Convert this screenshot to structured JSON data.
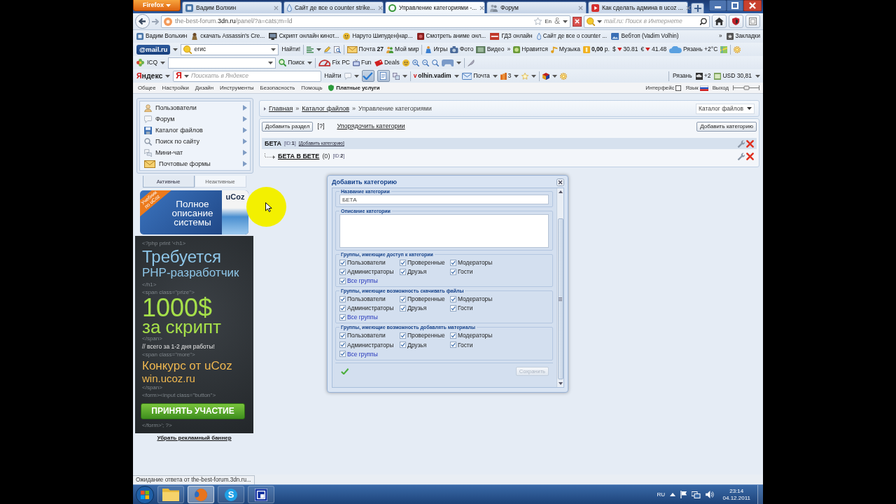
{
  "tab_strip": {
    "menu_button": "Firefox",
    "tabs": [
      {
        "title": "Вадим Волхин",
        "kind": "tile",
        "selected": false
      },
      {
        "title": "Сайт де все о counter strike...",
        "kind": "drop",
        "selected": false
      },
      {
        "title": "Управление категориями -...",
        "kind": "loading",
        "selected": true
      },
      {
        "title": "Форум",
        "kind": "forum",
        "selected": false
      },
      {
        "title": "Как сделать админа в ucoz ...",
        "kind": "video",
        "selected": false
      }
    ]
  },
  "nav_bar": {
    "url": {
      "host": "the-best-forum.",
      "domain": "3dn.ru",
      "path": "/panel/?a=cats;m=ld"
    },
    "addons": [
      "En",
      "&"
    ],
    "search": {
      "placeholder": "mail.ru: Поиск в Интернете"
    }
  },
  "bookmarks_bar": {
    "items": [
      {
        "label": "Вадим Вольхин",
        "kind": "tile"
      },
      {
        "label": "скачать Assassin's Cre...",
        "kind": "figure"
      },
      {
        "label": "Скрипт онлайн кинот...",
        "kind": "monitor"
      },
      {
        "label": "Наруто Шипуден|нар...",
        "kind": "emoji"
      },
      {
        "label": "Смотреть аниме онл...",
        "kind": "picture"
      },
      {
        "label": "ГДЗ онлайн",
        "kind": "logo"
      },
      {
        "label": "Сайт де все о counter ...",
        "kind": "drop"
      },
      {
        "label": "Вебтоп (Vadim Volhin)",
        "kind": "landscape"
      }
    ],
    "overflow": "»",
    "menu": "Закладки"
  },
  "mail_toolbar": {
    "logo": "@mail.ru",
    "search": {
      "value": "егис"
    },
    "search_button": "Найти!",
    "items": [
      {
        "kind": "fontsize"
      },
      {
        "kind": "caret"
      },
      {
        "kind": "pen"
      },
      {
        "kind": "pagesearch"
      },
      {
        "kind": "sep"
      },
      {
        "kind": "envelope",
        "label": "Почта **27**"
      },
      {
        "kind": "people",
        "label": "Мой мир"
      },
      {
        "kind": "sep"
      },
      {
        "kind": "figure2",
        "label": "Игры"
      },
      {
        "kind": "camera",
        "label": "Фото"
      },
      {
        "kind": "film",
        "label": "Видео"
      },
      {
        "kind": "text",
        "label": "»"
      },
      {
        "kind": "like",
        "label": "Нравится"
      },
      {
        "kind": "music",
        "label": "Музыка"
      },
      {
        "kind": "coin",
        "label": "**0,00** р."
      },
      {
        "kind": "rate",
        "symbol": "$",
        "label": "30.81"
      },
      {
        "kind": "rate",
        "symbol": "€",
        "label": "41.48"
      },
      {
        "kind": "cloud",
        "label": "Рязань +2°C"
      },
      {
        "kind": "map"
      },
      {
        "kind": "sep"
      },
      {
        "kind": "gear"
      }
    ]
  },
  "icq_toolbar": {
    "label": "ICQ",
    "search_button": "Поиск",
    "items": [
      {
        "kind": "caret"
      },
      {
        "kind": "sep"
      },
      {
        "kind": "fixpc",
        "label": "Fix PC"
      },
      {
        "kind": "tv",
        "label": "Fun"
      },
      {
        "kind": "ticket",
        "label": "Deals"
      },
      {
        "kind": "emoji"
      },
      {
        "kind": "zoomin"
      },
      {
        "kind": "zoomout"
      },
      {
        "kind": "zoom"
      },
      {
        "kind": "gamepad"
      },
      {
        "kind": "caret"
      },
      {
        "kind": "sep"
      },
      {
        "kind": "feather"
      }
    ]
  },
  "yandex_toolbar": {
    "logo": "Яндекс",
    "search": {
      "glyph": "Я",
      "placeholder": "Поискать в Яндексе"
    },
    "search_button": "Найти",
    "items": [
      {
        "kind": "bubble"
      },
      {
        "kind": "caret"
      }
    ],
    "toggles": [
      {
        "kind": "check",
        "pressed": true
      },
      {
        "kind": "document",
        "pressed": true
      }
    ],
    "more_items": [
      {
        "kind": "translate"
      },
      {
        "kind": "caret"
      },
      {
        "kind": "sep"
      },
      {
        "kind": "login",
        "label": "volhin.vadim"
      },
      {
        "kind": "caret"
      },
      {
        "kind": "mail",
        "label": "Почта"
      },
      {
        "kind": "caret"
      },
      {
        "kind": "books",
        "label": "3"
      },
      {
        "kind": "caret"
      },
      {
        "kind": "star"
      },
      {
        "kind": "caret"
      },
      {
        "kind": "sep"
      },
      {
        "kind": "cube"
      },
      {
        "kind": "caret"
      },
      {
        "kind": "gear"
      }
    ],
    "right_items": [
      {
        "kind": "sep"
      },
      {
        "kind": "text",
        "label": "Рязань"
      },
      {
        "kind": "weather",
        "label": "+2"
      },
      {
        "kind": "currency",
        "label": "USD 30,81"
      },
      {
        "kind": "caret"
      }
    ]
  },
  "admin_bar": {
    "menu": [
      "Общее",
      "Настройки",
      "Дизайн",
      "Инструменты",
      "Безопасность",
      "Помощь"
    ],
    "paid_services": "Платные услуги",
    "interface": "Интерфейс",
    "language": "Язык",
    "logout": "Выход"
  },
  "sidebar": {
    "menu": [
      {
        "label": "Пользователи",
        "kind": "person"
      },
      {
        "label": "Форум",
        "kind": "bubble"
      },
      {
        "label": "Каталог файлов",
        "kind": "floppy"
      },
      {
        "label": "Поиск по сайту",
        "kind": "magnifier"
      },
      {
        "label": "Мини-чат",
        "kind": "chat"
      },
      {
        "label": "Почтовые формы",
        "kind": "envelope"
      }
    ],
    "tabs": [
      {
        "label": "Активные",
        "selected": true
      },
      {
        "label": "Неактивные",
        "selected": false
      }
    ],
    "promo_banner": {
      "ribbon": "Учебник по uCoz",
      "text": "Полное описание системы",
      "book_title": "uCoz"
    },
    "ad_banner": {
      "lines": [
        {
          "kind": "code",
          "text": "<?php print '<h1>"
        },
        {
          "kind": "title",
          "text": "Требуется"
        },
        {
          "kind": "subtitle",
          "text": "PHP-разработчик"
        },
        {
          "kind": "code",
          "text": "</h1>"
        },
        {
          "kind": "code",
          "text": "<span class=\"prize\">"
        },
        {
          "kind": "prize",
          "text": "1000$"
        },
        {
          "kind": "prizenote",
          "text": "за скрипт"
        },
        {
          "kind": "code",
          "text": "</span>"
        },
        {
          "kind": "comment",
          "text": "// всего за 1-2 дня работы!"
        },
        {
          "kind": "code",
          "text": "<span class=\"more\">"
        },
        {
          "kind": "contest",
          "text": "Конкурс от uCoz"
        },
        {
          "kind": "contesturl",
          "text": "win.ucoz.ru"
        },
        {
          "kind": "code",
          "text": "</span>"
        },
        {
          "kind": "code",
          "text": "<form><input class=\"button\">"
        },
        {
          "kind": "button",
          "text": "ПРИНЯТЬ УЧАСТИЕ"
        },
        {
          "kind": "code",
          "text": "</form>'; ?>"
        }
      ]
    },
    "remove_banner_link": "Убрать рекламный баннер"
  },
  "breadcrumb": [
    {
      "label": "Главная",
      "kind": "link"
    },
    {
      "label": "»",
      "kind": "sep"
    },
    {
      "label": "Каталог файлов",
      "kind": "link"
    },
    {
      "label": "»",
      "kind": "sep"
    },
    {
      "label": "Управление категориями",
      "kind": "current"
    }
  ],
  "module_select": {
    "value": "Каталог файлов"
  },
  "actions": {
    "add_section": "Добавить раздел",
    "help": "[?]",
    "sort_link": "Упорядочить категории",
    "add_category": "Добавить категорию"
  },
  "categories": [
    {
      "name": "БЕТА",
      "id": "[ID:**1**]",
      "add_link": "[Добавить категорию]",
      "children": [
        {
          "name": "БЕТА В БЕТЕ",
          "count": "(0)",
          "id": "[ID:**2**]"
        }
      ]
    }
  ],
  "dialog": {
    "title": "Добавить категорию",
    "name_field": {
      "legend": "Название категории",
      "value": "БЕТА"
    },
    "description_field": {
      "legend": "Описание категории"
    },
    "group_sets": [
      {
        "legend": "Группы, имеющие доступ к категории",
        "options": [
          {
            "label": "Пользователи",
            "checked": true
          },
          {
            "label": "Проверенные",
            "checked": true
          },
          {
            "label": "Модераторы",
            "checked": true
          },
          {
            "label": "Администраторы",
            "checked": true
          },
          {
            "label": "Друзья",
            "checked": true
          },
          {
            "label": "Гости",
            "checked": true
          }
        ],
        "all": {
          "label": "Все группы",
          "checked": true
        }
      },
      {
        "legend": "Группы, имеющие возможность скачивать файлы",
        "options": [
          {
            "label": "Пользователи",
            "checked": true
          },
          {
            "label": "Проверенные",
            "checked": true
          },
          {
            "label": "Модераторы",
            "checked": true
          },
          {
            "label": "Администраторы",
            "checked": true
          },
          {
            "label": "Друзья",
            "checked": true
          },
          {
            "label": "Гости",
            "checked": true
          }
        ],
        "all": {
          "label": "Все группы",
          "checked": true
        }
      },
      {
        "legend": "Группы, имеющие возможность добавлять материалы",
        "options": [
          {
            "label": "Пользователи",
            "checked": true
          },
          {
            "label": "Проверенные",
            "checked": true
          },
          {
            "label": "Модераторы",
            "checked": true
          },
          {
            "label": "Администраторы",
            "checked": true
          },
          {
            "label": "Друзья",
            "checked": true
          },
          {
            "label": "Гости",
            "checked": true
          }
        ],
        "all": {
          "label": "Все группы",
          "checked": true
        }
      }
    ],
    "save_button": {
      "label": "Сохранить",
      "disabled": true
    }
  },
  "status_bar": {
    "text": "Ожидание ответа от the-best-forum.3dn.ru..."
  },
  "taskbar": {
    "apps": [
      {
        "kind": "folder",
        "selected": false
      },
      {
        "kind": "browser",
        "selected": true
      },
      {
        "kind": "messenger",
        "glyph": "S",
        "selected": false
      },
      {
        "kind": "window",
        "selected": false
      }
    ],
    "language": "RU",
    "time": "23:14",
    "date": "04.12.2011"
  }
}
